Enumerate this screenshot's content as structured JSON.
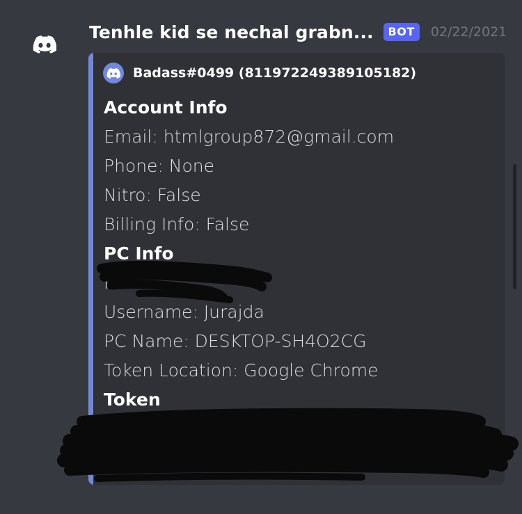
{
  "message": {
    "username": "Tenhle kid se nechal grabn...",
    "badge": "BOT",
    "timestamp": "02/22/2021",
    "avatar_icon": "discord-logo-icon"
  },
  "embed": {
    "accent_color": "#7289da",
    "author": {
      "icon": "discord-logo-icon",
      "name": "Badass#0499 (811972249389105182)"
    },
    "lines": [
      {
        "type": "title",
        "text": "Account Info"
      },
      {
        "type": "value",
        "text": "Email: htmlgroup872@gmail.com"
      },
      {
        "type": "value",
        "text": "Phone: None"
      },
      {
        "type": "value",
        "text": "Nitro: False"
      },
      {
        "type": "value",
        "text": "Billing Info: False"
      },
      {
        "type": "title",
        "text": "PC Info"
      },
      {
        "type": "value",
        "text": "I                              18"
      },
      {
        "type": "value",
        "text": "Username: Jurajda"
      },
      {
        "type": "value",
        "text": "PC Name: DESKTOP-SH4O2CG"
      },
      {
        "type": "value",
        "text": "Token Location: Google Chrome"
      },
      {
        "type": "title",
        "text": "Token"
      }
    ]
  }
}
